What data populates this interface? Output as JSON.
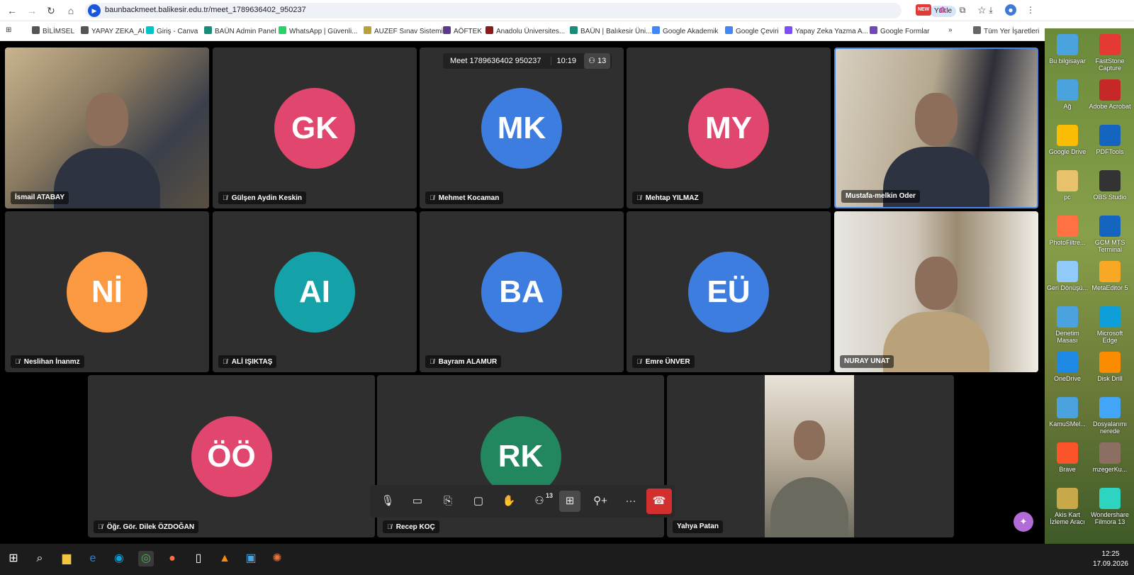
{
  "browser": {
    "url": "baunbackmeet.balikesir.edu.tr/meet_1789636402_950237",
    "install_label": "Yükle",
    "new_badge": "NEW"
  },
  "bookmarks": [
    {
      "label": "BİLİMSEL",
      "color": "#555555"
    },
    {
      "label": "YAPAY ZEKA_AI",
      "color": "#555555"
    },
    {
      "label": "Giriş - Canva",
      "color": "#00c4cc"
    },
    {
      "label": "BAÜN Admin Panel",
      "color": "#1a8c7a"
    },
    {
      "label": "WhatsApp | Güvenli...",
      "color": "#25d366"
    },
    {
      "label": "AUZEF Sınav Sistemi",
      "color": "#b8a13a"
    },
    {
      "label": "AÖFTEK",
      "color": "#5b3a8c"
    },
    {
      "label": "Anadolu Üniversites...",
      "color": "#8b1a1a"
    },
    {
      "label": "BAÜN | Balıkesir Üni...",
      "color": "#1a8c7a"
    },
    {
      "label": "Google Akademik",
      "color": "#4285f4"
    },
    {
      "label": "Google Çeviri",
      "color": "#4285f4"
    },
    {
      "label": "Yapay Zeka Yazma A...",
      "color": "#7c4dff"
    },
    {
      "label": "Google Formlar",
      "color": "#7248b9"
    }
  ],
  "bookmarks_overflow": "»",
  "bookmarks_all": "Tüm Yer İşaretleri",
  "meeting": {
    "title": "Meet 1789636402 950237",
    "time": "10:19",
    "participant_count": "13"
  },
  "participants": [
    {
      "name": "İsmail ATABAY",
      "initials": "",
      "video": true
    },
    {
      "name": "Gülşen Aydin Keskin",
      "initials": "GK",
      "color": "#e0466e"
    },
    {
      "name": "Mehmet Kocaman",
      "initials": "MK",
      "color": "#3e7de0"
    },
    {
      "name": "Mehtap YILMAZ",
      "initials": "MY",
      "color": "#e0466e"
    },
    {
      "name": "Mustafa-melkin Oder",
      "initials": "",
      "video": true
    },
    {
      "name": "Neslihan İnanmz",
      "initials": "Nİ",
      "color": "#fb9a43"
    },
    {
      "name": "ALİ IŞIKTAŞ",
      "initials": "AI",
      "color": "#14a1a8"
    },
    {
      "name": "Bayram ALAMUR",
      "initials": "BA",
      "color": "#3e7de0"
    },
    {
      "name": "Emre ÜNVER",
      "initials": "EÜ",
      "color": "#3e7de0"
    },
    {
      "name": "NURAY UNAT",
      "initials": "",
      "video": true
    },
    {
      "name": "Öğr. Gör. Dilek ÖZDOĞAN",
      "initials": "ÖÖ",
      "color": "#e0466e"
    },
    {
      "name": "Recep KOÇ",
      "initials": "RK",
      "color": "#22865f"
    },
    {
      "name": "Yahya Patan",
      "initials": "",
      "video": true
    }
  ],
  "toolbar": {
    "participants_badge": "13"
  },
  "desktop_icons": [
    {
      "label": "Bu bilgisayar",
      "color": "#4aa3df"
    },
    {
      "label": "FastStone Capture",
      "color": "#e53935"
    },
    {
      "label": "Ağ",
      "color": "#4aa3df"
    },
    {
      "label": "Adobe Acrobat",
      "color": "#c62828"
    },
    {
      "label": "Google Drive",
      "color": "#fbbc05"
    },
    {
      "label": "PDFTools",
      "color": "#1565c0"
    },
    {
      "label": "pc",
      "color": "#e8c26a"
    },
    {
      "label": "OBS Studio",
      "color": "#333333"
    },
    {
      "label": "PhotoFiltre...",
      "color": "#ff7043"
    },
    {
      "label": "GCM MTS Terminal",
      "color": "#1565c0"
    },
    {
      "label": "Geri Dönüşü...",
      "color": "#90caf9"
    },
    {
      "label": "MetaEditor 5",
      "color": "#f9a825"
    },
    {
      "label": "Denetim Masası",
      "color": "#4aa3df"
    },
    {
      "label": "Microsoft Edge",
      "color": "#0f9fd8"
    },
    {
      "label": "OneDrive",
      "color": "#1e88e5"
    },
    {
      "label": "Disk Drill",
      "color": "#fb8c00"
    },
    {
      "label": "KamuSMel...",
      "color": "#4aa3df"
    },
    {
      "label": "Dosyalarımı nerede",
      "color": "#42a5f5"
    },
    {
      "label": "Brave",
      "color": "#fb542b"
    },
    {
      "label": "mzegerKu...",
      "color": "#8d6e63"
    },
    {
      "label": "Akis Kart İzleme Aracı",
      "color": "#c8a848"
    },
    {
      "label": "Wondershare Filmora 13",
      "color": "#2dd4bf"
    }
  ],
  "taskbar": {
    "time": "12:25",
    "date": "17.09.2026"
  }
}
